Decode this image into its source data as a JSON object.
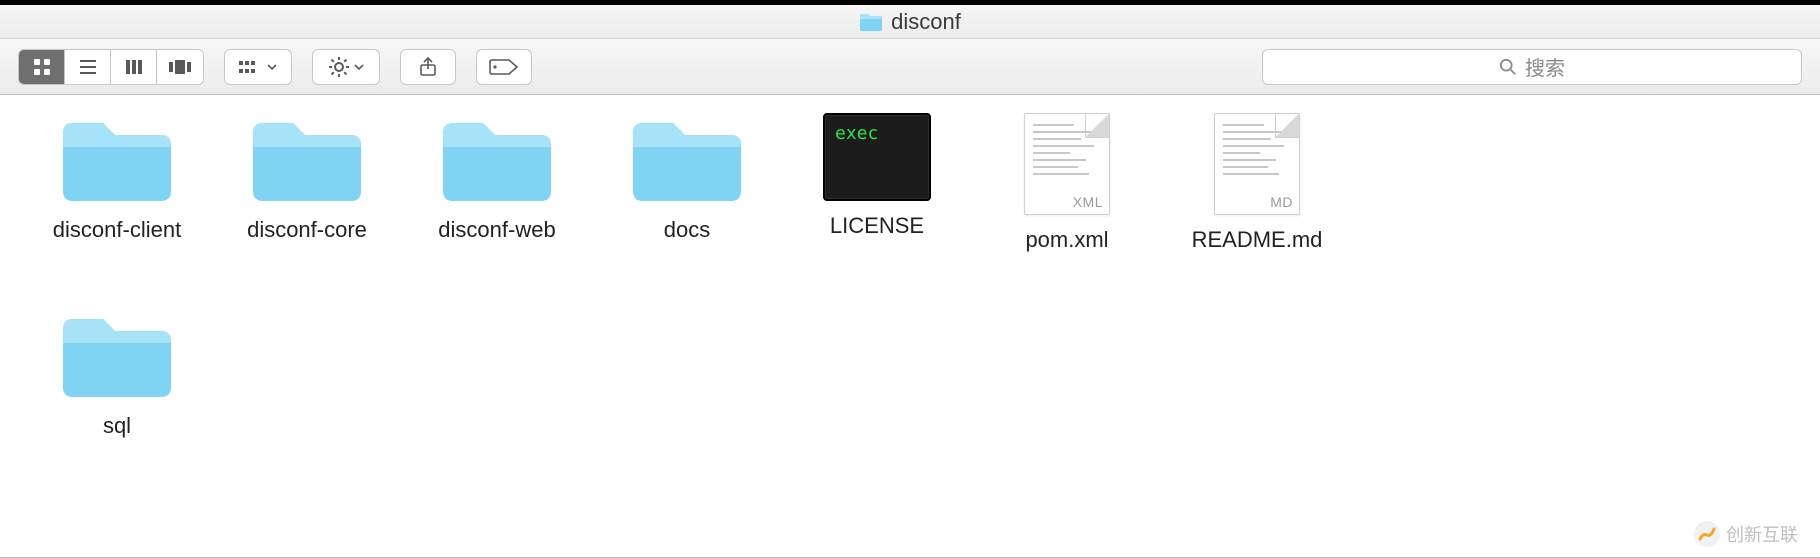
{
  "window": {
    "title": "disconf"
  },
  "toolbar": {
    "views": [
      "icon",
      "list",
      "columns",
      "coverflow"
    ],
    "active_view": "icon"
  },
  "search": {
    "placeholder": "搜索"
  },
  "items": [
    {
      "name": "disconf-client",
      "type": "folder"
    },
    {
      "name": "disconf-core",
      "type": "folder"
    },
    {
      "name": "disconf-web",
      "type": "folder"
    },
    {
      "name": "docs",
      "type": "folder"
    },
    {
      "name": "LICENSE",
      "type": "exec",
      "exec_label": "exec"
    },
    {
      "name": "pom.xml",
      "type": "doc",
      "ext": "XML"
    },
    {
      "name": "README.md",
      "type": "doc",
      "ext": "MD"
    },
    {
      "name": "sql",
      "type": "folder"
    }
  ],
  "watermark": {
    "text": "创新互联"
  }
}
